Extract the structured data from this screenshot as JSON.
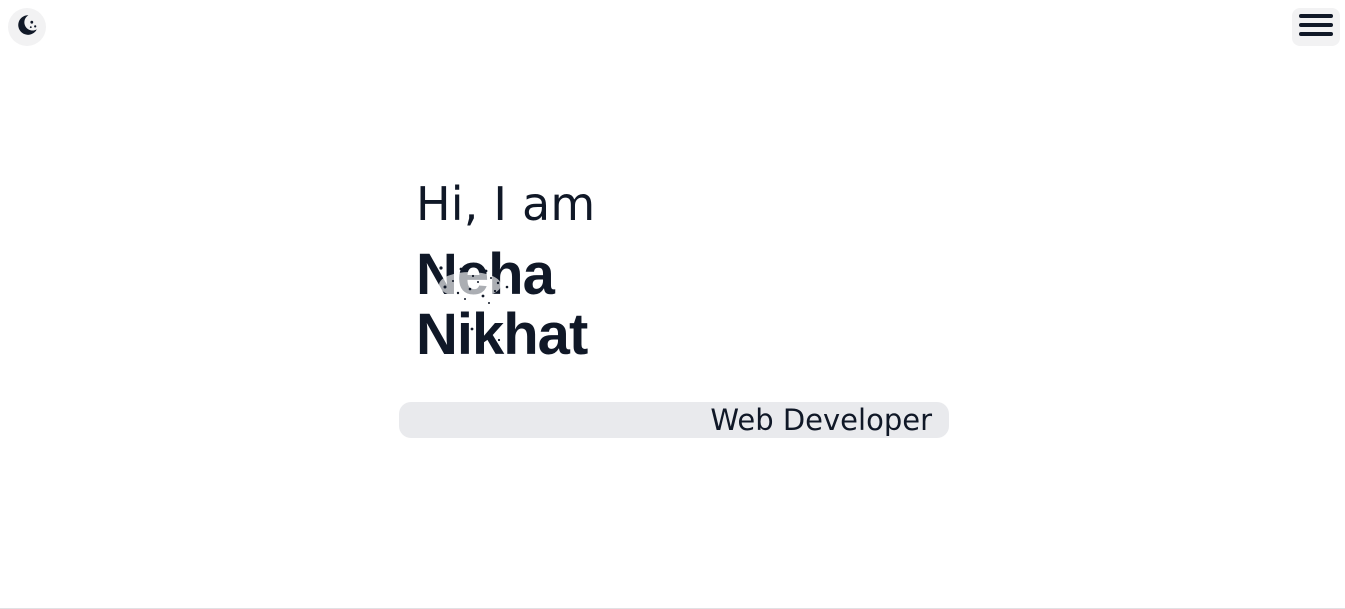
{
  "header": {
    "theme_toggle_icon": "moon-stars-icon",
    "menu_icon": "hamburger-menu-icon"
  },
  "hero": {
    "greeting": "Hi, I am",
    "name_first": "Neha",
    "name_last": "Nikhat",
    "role": "Web Developer"
  },
  "colors": {
    "text": "#101827",
    "pill_background": "#e9eaed",
    "button_background": "#f2f2f3"
  }
}
